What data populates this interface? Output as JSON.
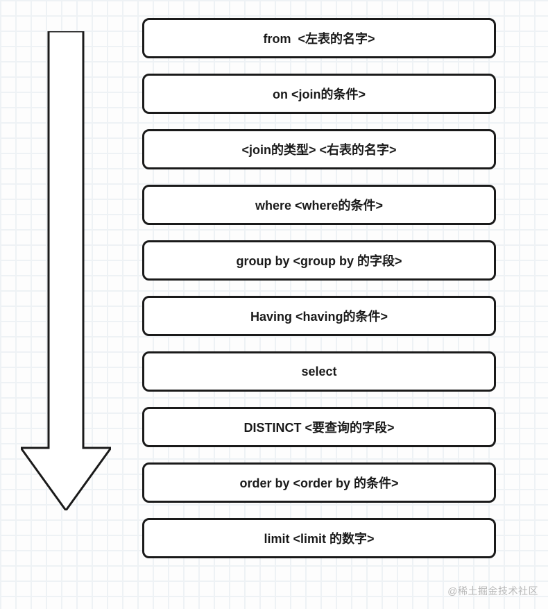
{
  "diagram": {
    "steps": [
      {
        "label": "from  <左表的名字>"
      },
      {
        "label": "on <join的条件>"
      },
      {
        "label": "<join的类型> <右表的名字>"
      },
      {
        "label": "where <where的条件>"
      },
      {
        "label": "group by <group by 的字段>"
      },
      {
        "label": "Having <having的条件>"
      },
      {
        "label": "select"
      },
      {
        "label": "DISTINCT <要查询的字段>"
      },
      {
        "label": "order by <order by 的条件>"
      },
      {
        "label": "limit <limit 的数字>"
      }
    ]
  },
  "arrow": {
    "color": "#1a1a1a",
    "stroke_width": 3
  },
  "watermark": "@稀土掘金技术社区"
}
